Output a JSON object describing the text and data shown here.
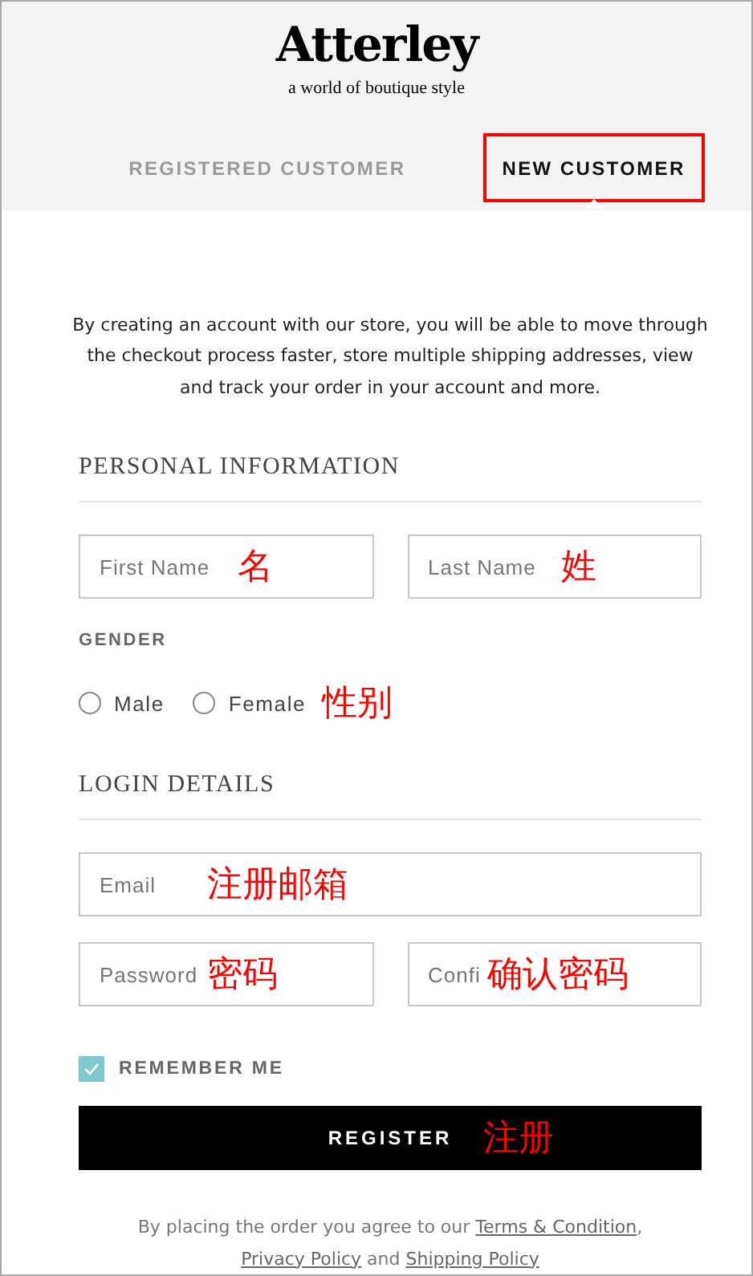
{
  "brand": {
    "logo": "Atterley",
    "tagline": "a world of boutique style"
  },
  "tabs": [
    {
      "label": "REGISTERED CUSTOMER",
      "selected": false,
      "highlighted": false
    },
    {
      "label": "NEW CUSTOMER",
      "selected": true,
      "highlighted": true
    }
  ],
  "intro": "By creating an account with our store, you will be able to move through the checkout process faster, store multiple shipping addresses, view and track your order in your account and more.",
  "personal": {
    "heading": "PERSONAL INFORMATION",
    "fields": [
      {
        "placeholder": "First Name",
        "annotation": "名"
      },
      {
        "placeholder": "Last Name",
        "annotation": "姓"
      }
    ],
    "gender_label": "GENDER",
    "gender_options": [
      {
        "label": "Male",
        "selected": false
      },
      {
        "label": "Female",
        "selected": false
      }
    ],
    "gender_annotation": "性别"
  },
  "login": {
    "heading": "LOGIN DETAILS",
    "email": {
      "placeholder": "Email",
      "annotation": "注册邮箱"
    },
    "passwords": [
      {
        "placeholder": "Password",
        "annotation": "密码"
      },
      {
        "placeholder": "Confi",
        "annotation": "确认密码"
      }
    ]
  },
  "remember": {
    "label": "REMEMBER ME",
    "checked": true
  },
  "register": {
    "label": "REGISTER",
    "annotation": "注册"
  },
  "legal": [
    {
      "kind": "text",
      "text": "By placing the order you agree to our "
    },
    {
      "kind": "link",
      "text": "Terms & Condition"
    },
    {
      "kind": "text",
      "text": ", "
    },
    {
      "kind": "link",
      "text": "Privacy Policy"
    },
    {
      "kind": "text",
      "text": " and "
    },
    {
      "kind": "link",
      "text": "Shipping Policy"
    }
  ]
}
